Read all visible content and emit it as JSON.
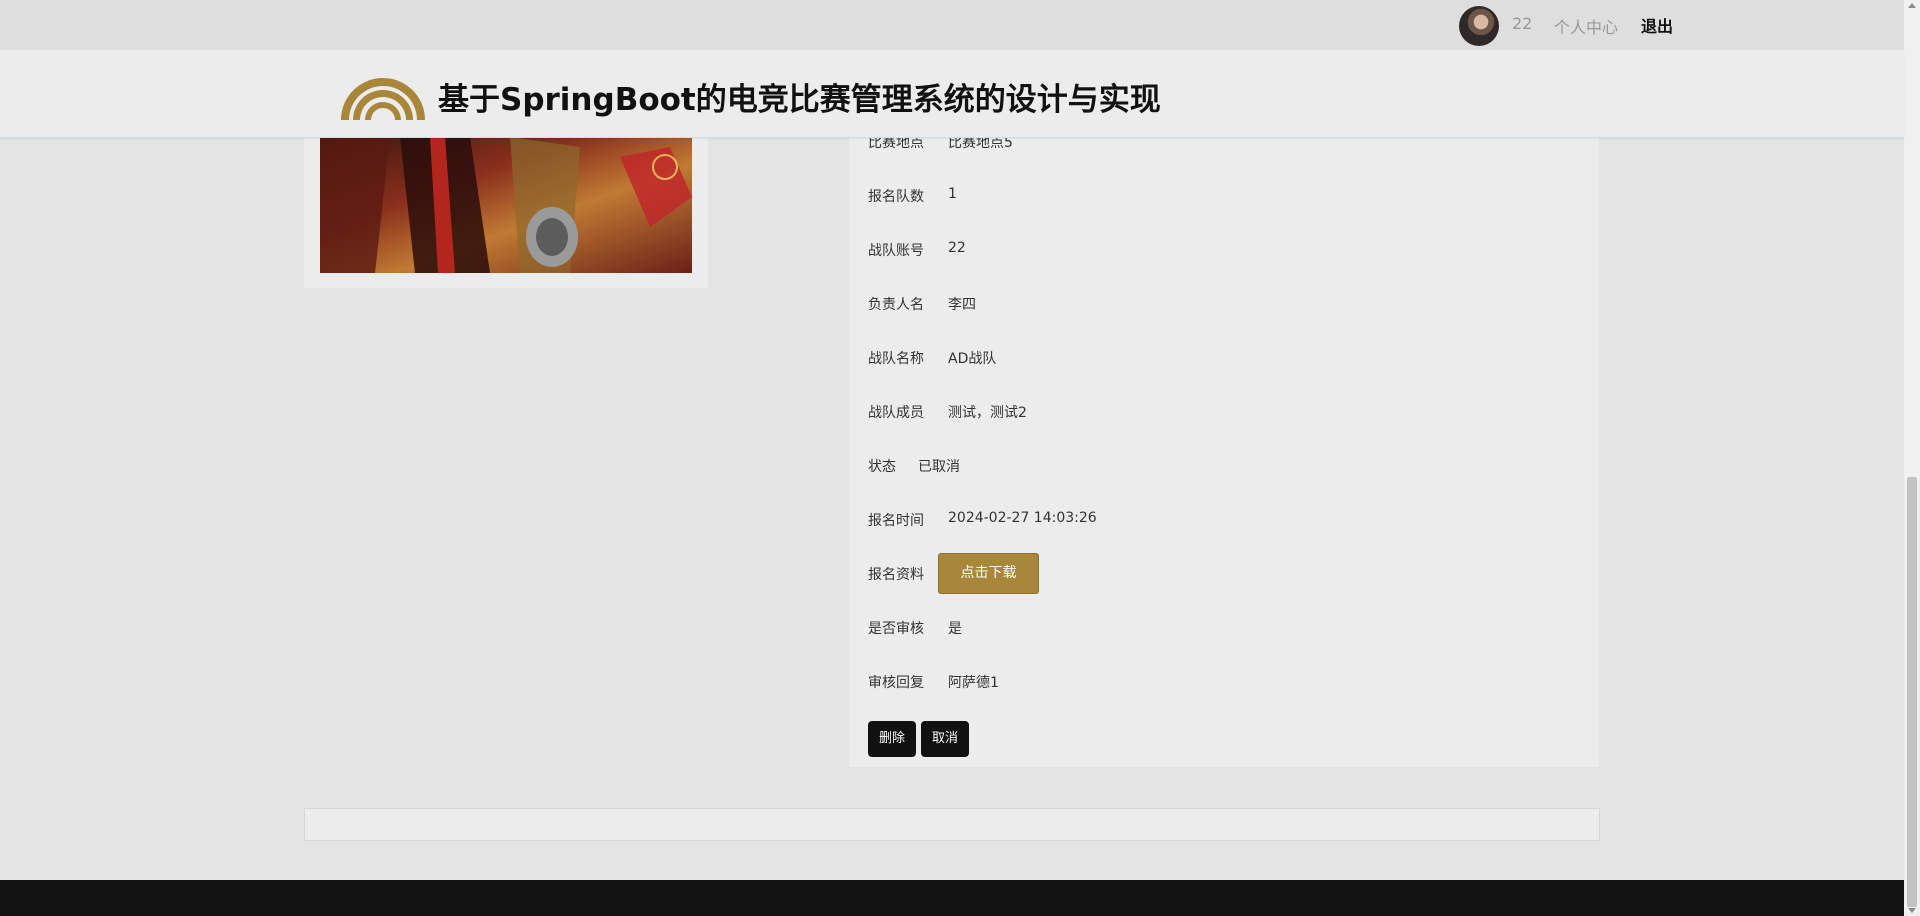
{
  "topbar": {
    "username": "22",
    "personal_center": "个人中心",
    "logout": "退出"
  },
  "header": {
    "site_title": "基于SpringBoot的电竞比赛管理系统的设计与实现"
  },
  "detail": {
    "rows": [
      {
        "label": "比赛地点",
        "value": "比赛地点5"
      },
      {
        "label": "报名队数",
        "value": "1"
      },
      {
        "label": "战队账号",
        "value": "22"
      },
      {
        "label": "负责人名",
        "value": "李四"
      },
      {
        "label": "战队名称",
        "value": "AD战队"
      },
      {
        "label": "战队成员",
        "value": "测试，测试2"
      },
      {
        "label": "状态",
        "value": "已取消"
      },
      {
        "label": "报名时间",
        "value": "2024-02-27 14:03:26"
      },
      {
        "label": "报名资料",
        "value": ""
      },
      {
        "label": "是否审核",
        "value": "是"
      },
      {
        "label": "审核回复",
        "value": "阿萨德1"
      }
    ],
    "download_label": "点击下载",
    "delete_label": "删除",
    "cancel_label": "取消"
  },
  "colors": {
    "accent_gold": "#a8873a",
    "footer_dark": "#121212"
  }
}
